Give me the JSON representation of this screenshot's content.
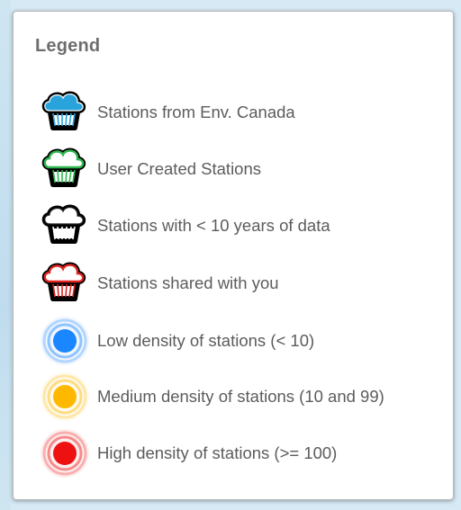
{
  "legend": {
    "title": "Legend",
    "items": [
      {
        "label": "Stations from Env. Canada",
        "icon": "cloud-rain-icon",
        "color": "#29a3db"
      },
      {
        "label": "User Created Stations",
        "icon": "cloud-rain-icon",
        "color": "#2fb84f"
      },
      {
        "label": "Stations with < 10 years of data",
        "icon": "cloud-rain-icon",
        "color": "#ffffff"
      },
      {
        "label": "Stations shared with you",
        "icon": "cloud-rain-icon",
        "color": "#e02420"
      },
      {
        "label": "Low density of stations (< 10)",
        "icon": "density-circle-icon",
        "color": "#1a86ff"
      },
      {
        "label": "Medium density of stations (10 and 99)",
        "icon": "density-circle-icon",
        "color": "#ffb800"
      },
      {
        "label": "High density of stations (>= 100)",
        "icon": "density-circle-icon",
        "color": "#ee1111"
      }
    ]
  }
}
